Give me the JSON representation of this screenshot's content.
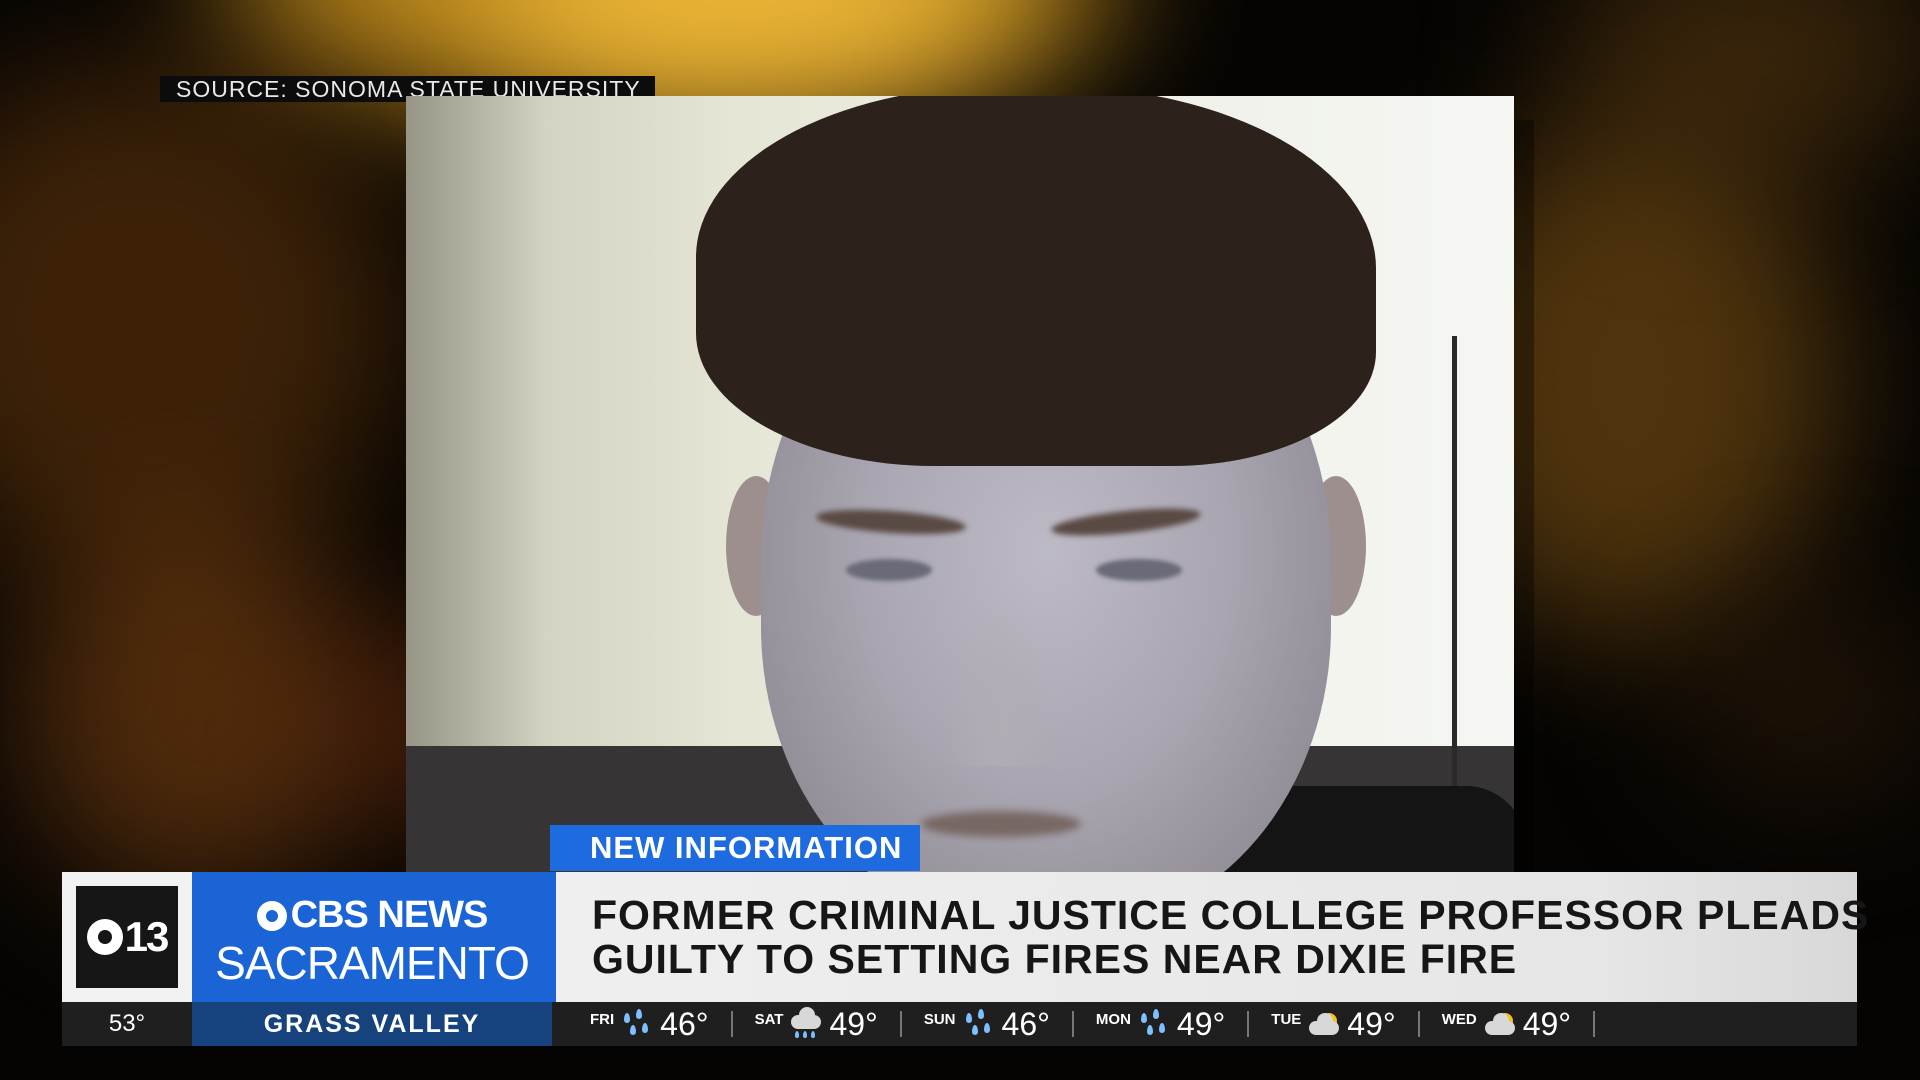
{
  "source_label": "SOURCE: SONOMA STATE UNIVERSITY",
  "lower_third": {
    "tag": "NEW INFORMATION",
    "headline_line1": "FORMER CRIMINAL JUSTICE COLLEGE PROFESSOR PLEADS",
    "headline_line2": "GUILTY TO SETTING FIRES NEAR DIXIE FIRE"
  },
  "branding": {
    "channel_number": "13",
    "network": "CBS NEWS",
    "city": "SACRAMENTO",
    "accent_color": "#1a64d6"
  },
  "ticker": {
    "current_temp": "53°",
    "location": "GRASS VALLEY",
    "forecast": [
      {
        "day": "FRI",
        "icon": "rain-icon",
        "temp": "46°"
      },
      {
        "day": "SAT",
        "icon": "rain-cloud-icon",
        "temp": "49°"
      },
      {
        "day": "SUN",
        "icon": "rain-icon",
        "temp": "46°"
      },
      {
        "day": "MON",
        "icon": "rain-icon",
        "temp": "49°"
      },
      {
        "day": "TUE",
        "icon": "partly-cloudy-icon",
        "temp": "49°"
      },
      {
        "day": "WED",
        "icon": "partly-cloudy-icon",
        "temp": "49°"
      }
    ]
  }
}
